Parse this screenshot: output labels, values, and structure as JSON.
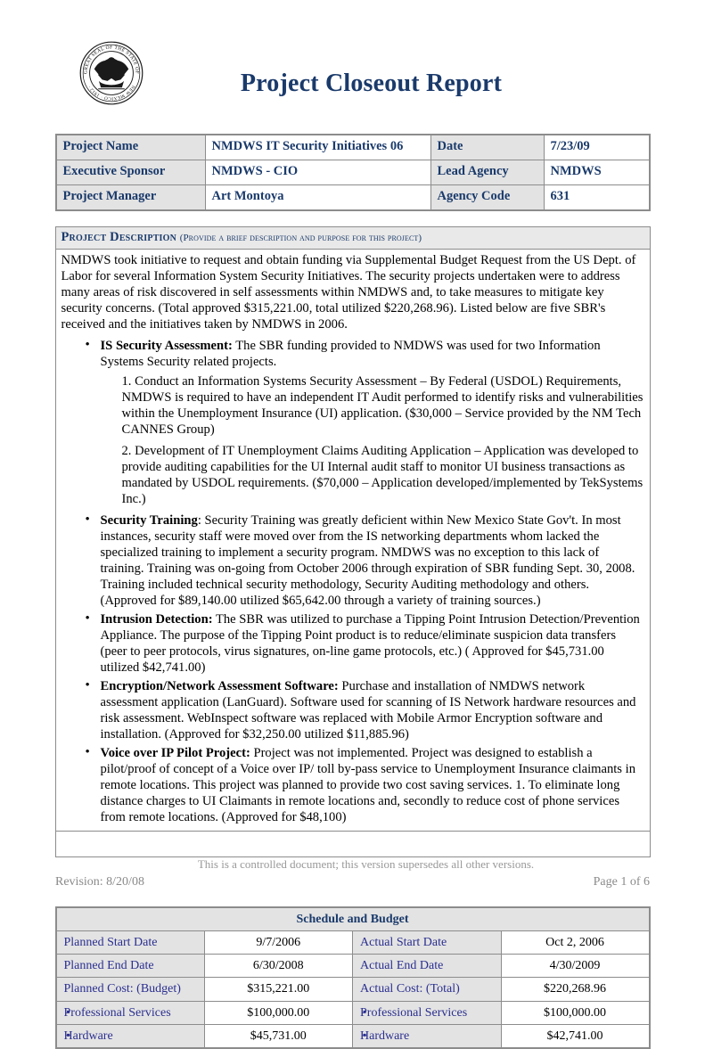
{
  "header": {
    "title": "Project Closeout Report",
    "seal_icon": "nm-state-seal-icon",
    "seal_text_top": "GREAT SEAL OF THE STATE OF",
    "seal_text_bottom": "NEW MEXICO · 1912 ·"
  },
  "info_table": {
    "rows": [
      {
        "label": "Project Name",
        "value": "NMDWS IT Security Initiatives 06",
        "label2": "Date",
        "value2": "7/23/09"
      },
      {
        "label": "Executive Sponsor",
        "value": "NMDWS - CIO",
        "label2": "Lead Agency",
        "value2": "NMDWS"
      },
      {
        "label": "Project Manager",
        "value": "Art Montoya",
        "label2": "Agency Code",
        "value2": "631"
      }
    ]
  },
  "description": {
    "heading": "Project Description",
    "heading_note": "(Provide a brief description and purpose for this project)",
    "intro": "NMDWS took initiative to request and obtain funding via Supplemental Budget Request from the US Dept. of Labor for several Information System Security Initiatives.  The security projects undertaken were to address many areas of risk discovered in self assessments within NMDWS and, to take measures to mitigate key security concerns.  (Total approved $315,221.00, total utilized $220,268.96). Listed below are five SBR's received and the initiatives taken by NMDWS in 2006.",
    "bullets": [
      {
        "term": "IS Security Assessment:",
        "text": " The SBR funding provided to NMDWS was used for two Information Systems Security related projects.",
        "subitems": [
          "1.  Conduct an Information Systems Security Assessment – By Federal (USDOL) Requirements, NMDWS is required to have an independent IT Audit performed to identify risks and vulnerabilities within the Unemployment Insurance (UI) application. ($30,000 – Service provided by the NM Tech CANNES Group)",
          "2.  Development of IT Unemployment Claims Auditing Application – Application was developed to provide auditing capabilities for the UI Internal audit staff to monitor UI business transactions as mandated by USDOL requirements.  ($70,000 – Application developed/implemented by TekSystems Inc.)"
        ]
      },
      {
        "term": "Security Training",
        "text": ":  Security Training was greatly deficient within New Mexico State Gov't.  In most instances, security staff were moved over from the IS networking departments whom lacked the specialized training to implement a security program.  NMDWS was no exception to this lack of training.  Training was on-going from October 2006 through expiration of SBR funding Sept. 30, 2008. Training included technical security methodology, Security Auditing methodology and others.  (Approved for $89,140.00 utilized $65,642.00 through a variety of training sources.)",
        "subitems": []
      },
      {
        "term": "Intrusion Detection:",
        "text": "  The SBR was utilized to purchase a Tipping Point Intrusion Detection/Prevention Appliance. The purpose of the Tipping Point product is to reduce/eliminate suspicion data transfers (peer to peer protocols, virus signatures, on-line game protocols, etc.)  ( Approved for $45,731.00 utilized $42,741.00)",
        "subitems": []
      },
      {
        "term": "Encryption/Network Assessment Software:",
        "text": "  Purchase and installation of NMDWS network assessment application (LanGuard).  Software used for scanning of IS Network hardware resources and risk assessment. WebInspect software was replaced with Mobile Armor Encryption software and installation.  (Approved for $32,250.00 utilized $11,885.96)",
        "subitems": []
      },
      {
        "term": "Voice over IP Pilot Project:",
        "text": " Project was not implemented. Project was designed to establish a pilot/proof of concept of a Voice over IP/ toll by-pass service to Unemployment Insurance claimants in remote locations.  This project was planned to provide two cost saving services.  1. To eliminate long distance charges to UI Claimants in remote locations and, secondly to reduce cost of phone services from remote locations.   (Approved for $48,100)",
        "subitems": []
      }
    ]
  },
  "budget": {
    "title": "Schedule and Budget",
    "rows": [
      {
        "label": "Planned Start Date",
        "value": "9/7/2006",
        "label2": "Actual Start Date",
        "value2": "Oct 2, 2006",
        "sub": false
      },
      {
        "label": "Planned End Date",
        "value": "6/30/2008",
        "label2": "Actual End Date",
        "value2": "4/30/2009",
        "sub": false
      },
      {
        "label": "Planned Cost: (Budget)",
        "value": "$315,221.00",
        "label2": "Actual Cost: (Total)",
        "value2": "$220,268.96",
        "sub": false
      },
      {
        "label": "Professional Services",
        "value": "$100,000.00",
        "label2": "Professional Services",
        "value2": "$100,000.00",
        "sub": true
      },
      {
        "label": "Hardware",
        "value": "$45,731.00",
        "label2": "Hardware",
        "value2": "$42,741.00",
        "sub": true
      }
    ]
  },
  "footer": {
    "note": "This is a controlled document; this version supersedes all other versions.",
    "revision": "Revision: 8/20/08",
    "page": "Page 1 of 6"
  },
  "colors": {
    "navy": "#1a3a6b",
    "label_blue": "#2b2f8f",
    "gray_fill": "#e3e3e3",
    "border": "#8c8c8c"
  }
}
